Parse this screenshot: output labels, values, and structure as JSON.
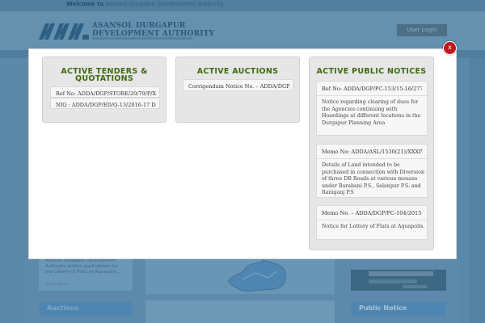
{
  "background": {
    "welcome_prefix": "Welcome to",
    "welcome_rest": "Asansol Durgapur Development Authority",
    "org_line1": "ASANSOL DURGAPUR",
    "org_line2": "DEVELOPMENT AUTHORITY",
    "login_label": "User Login",
    "left_card_text": "Asansol Durgapur Development Authority invites applications for the Lottery of Flats at Aquapolis...",
    "read_more": "Read more",
    "auctions_label": "Auctions",
    "public_notice_label": "Public Notice"
  },
  "modal": {
    "close_label": "x",
    "tenders": {
      "title_line1": "ACTIVE TENDERS &",
      "title_line2": "QUOTATIONS",
      "items": [
        "Ref No: ADDA/DGP/STORE/20/79/P/XIII/...",
        "NIQ : ADDA/DGP/ED/Q-13/2016-17 Dated ..."
      ]
    },
    "auctions": {
      "title": "ACTIVE AUCTIONS",
      "items": [
        "Corrigendum Notice No. – ADDA/DGP/P..."
      ]
    },
    "notices": {
      "title": "ACTIVE PUBLIC NOTICES",
      "items": [
        {
          "head": "Ref No: ADDA/DGP/PC-153/15-16/2779 Da...",
          "body": "Notice regarding clearing of dues for the Agencies continuing with Hoardings at different locations in the Durgapur Planning Area"
        },
        {
          "head": "Memo No: ADDA/ASL/1530(21)/XXXIV-1/1...",
          "body": "Details of Land intended to be purchased in connection with Diversion of three DB Roads at various mouzas under Barabani P.S., Salanpur P.S. and Raniganj P.S"
        },
        {
          "head": "Memo No. – ADDA/DGP/PC-104/2015-16/...",
          "body": "Notice for Lottery of Flats at Aquapolis."
        }
      ]
    }
  },
  "colors": {
    "overlay": "#5d8aaa",
    "title_green": "#3e6a12",
    "close_red": "#c2161c"
  }
}
